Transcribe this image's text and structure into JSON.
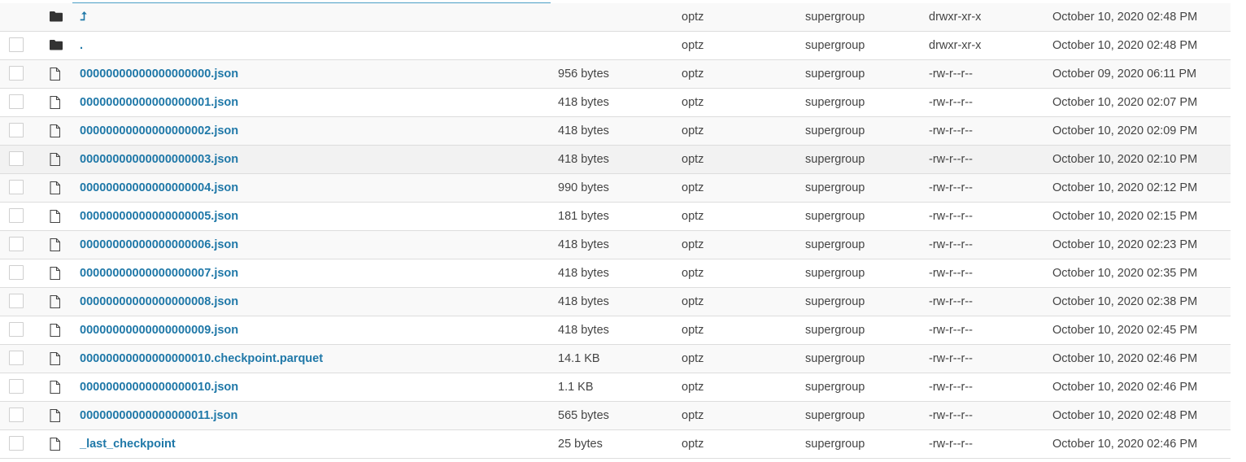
{
  "icons": {
    "folder": "folder-icon",
    "file": "file-icon",
    "parent": "up-arrow-icon"
  },
  "colors": {
    "link": "#1f78a8",
    "row_alt": "#f9f9f9",
    "border": "#dddddd",
    "text": "#444444"
  },
  "files": [
    {
      "type": "parent",
      "name": "⮥",
      "size": "",
      "owner": "optz",
      "group": "supergroup",
      "permission": "drwxr-xr-x",
      "modified": "October 10, 2020 02:48 PM"
    },
    {
      "type": "folder",
      "name": ".",
      "size": "",
      "owner": "optz",
      "group": "supergroup",
      "permission": "drwxr-xr-x",
      "modified": "October 10, 2020 02:48 PM"
    },
    {
      "type": "file",
      "name": "00000000000000000000.json",
      "size": "956 bytes",
      "owner": "optz",
      "group": "supergroup",
      "permission": "-rw-r--r--",
      "modified": "October 09, 2020 06:11 PM"
    },
    {
      "type": "file",
      "name": "00000000000000000001.json",
      "size": "418 bytes",
      "owner": "optz",
      "group": "supergroup",
      "permission": "-rw-r--r--",
      "modified": "October 10, 2020 02:07 PM"
    },
    {
      "type": "file",
      "name": "00000000000000000002.json",
      "size": "418 bytes",
      "owner": "optz",
      "group": "supergroup",
      "permission": "-rw-r--r--",
      "modified": "October 10, 2020 02:09 PM"
    },
    {
      "type": "file",
      "name": "00000000000000000003.json",
      "size": "418 bytes",
      "owner": "optz",
      "group": "supergroup",
      "permission": "-rw-r--r--",
      "modified": "October 10, 2020 02:10 PM"
    },
    {
      "type": "file",
      "name": "00000000000000000004.json",
      "size": "990 bytes",
      "owner": "optz",
      "group": "supergroup",
      "permission": "-rw-r--r--",
      "modified": "October 10, 2020 02:12 PM"
    },
    {
      "type": "file",
      "name": "00000000000000000005.json",
      "size": "181 bytes",
      "owner": "optz",
      "group": "supergroup",
      "permission": "-rw-r--r--",
      "modified": "October 10, 2020 02:15 PM"
    },
    {
      "type": "file",
      "name": "00000000000000000006.json",
      "size": "418 bytes",
      "owner": "optz",
      "group": "supergroup",
      "permission": "-rw-r--r--",
      "modified": "October 10, 2020 02:23 PM"
    },
    {
      "type": "file",
      "name": "00000000000000000007.json",
      "size": "418 bytes",
      "owner": "optz",
      "group": "supergroup",
      "permission": "-rw-r--r--",
      "modified": "October 10, 2020 02:35 PM"
    },
    {
      "type": "file",
      "name": "00000000000000000008.json",
      "size": "418 bytes",
      "owner": "optz",
      "group": "supergroup",
      "permission": "-rw-r--r--",
      "modified": "October 10, 2020 02:38 PM"
    },
    {
      "type": "file",
      "name": "00000000000000000009.json",
      "size": "418 bytes",
      "owner": "optz",
      "group": "supergroup",
      "permission": "-rw-r--r--",
      "modified": "October 10, 2020 02:45 PM"
    },
    {
      "type": "file",
      "name": "00000000000000000010.checkpoint.parquet",
      "size": "14.1 KB",
      "owner": "optz",
      "group": "supergroup",
      "permission": "-rw-r--r--",
      "modified": "October 10, 2020 02:46 PM"
    },
    {
      "type": "file",
      "name": "00000000000000000010.json",
      "size": "1.1 KB",
      "owner": "optz",
      "group": "supergroup",
      "permission": "-rw-r--r--",
      "modified": "October 10, 2020 02:46 PM"
    },
    {
      "type": "file",
      "name": "00000000000000000011.json",
      "size": "565 bytes",
      "owner": "optz",
      "group": "supergroup",
      "permission": "-rw-r--r--",
      "modified": "October 10, 2020 02:48 PM"
    },
    {
      "type": "file",
      "name": "_last_checkpoint",
      "size": "25 bytes",
      "owner": "optz",
      "group": "supergroup",
      "permission": "-rw-r--r--",
      "modified": "October 10, 2020 02:46 PM"
    }
  ]
}
